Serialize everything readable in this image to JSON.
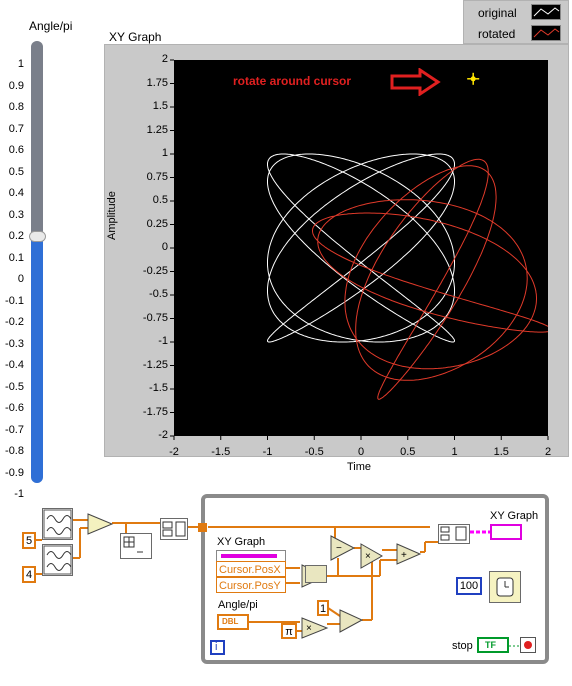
{
  "slider": {
    "title": "Angle/pi",
    "tick_labels": [
      "1",
      "0.9",
      "0.8",
      "0.7",
      "0.6",
      "0.5",
      "0.4",
      "0.3",
      "0.2",
      "0.1",
      "0",
      "-0.1",
      "-0.2",
      "-0.3",
      "-0.4",
      "-0.5",
      "-0.6",
      "-0.7",
      "-0.8",
      "-0.9",
      "-1"
    ],
    "value": 0.12,
    "min": -1,
    "max": 1,
    "fill_color": "#2f6fd6"
  },
  "graph": {
    "title": "XY Graph",
    "legend": [
      {
        "label": "original",
        "color": "#ffffff"
      },
      {
        "label": "rotated",
        "color": "#e03a2a"
      }
    ],
    "annotation": "rotate around cursor",
    "annotation_color": "#e02020",
    "cursor_color": "#ffe600"
  },
  "chart_data": {
    "type": "line",
    "xlabel": "Time",
    "ylabel": "Amplitude",
    "xlim": [
      -2,
      2
    ],
    "ylim": [
      -2,
      2
    ],
    "x_ticks": [
      "-2",
      "-1.5",
      "-1",
      "-0.5",
      "0",
      "0.5",
      "1",
      "1.5",
      "2"
    ],
    "y_ticks": [
      "2",
      "1.75",
      "1.5",
      "1.25",
      "1",
      "0.75",
      "0.5",
      "0.25",
      "0",
      "-0.25",
      "-0.5",
      "-0.75",
      "-1",
      "-1.25",
      "-1.5",
      "-1.75",
      "-2"
    ],
    "grid": false,
    "series": [
      {
        "name": "original",
        "frequencies": [
          5,
          4
        ],
        "color": "#ffffff"
      },
      {
        "name": "rotated",
        "frequencies": [
          5,
          4
        ],
        "rotation_pi": 0.12,
        "center": [
          1.2,
          1.8
        ],
        "color": "#e03a2a"
      }
    ],
    "cursor": {
      "x": 1.2,
      "y": 1.8
    }
  },
  "block_diagram": {
    "const_5": "5",
    "const_4": "4",
    "xy_graph_label": "XY Graph",
    "xy_graph_terminal": "XY Graph",
    "cursor_posx": "Cursor.PosX",
    "cursor_posy": "Cursor.PosY",
    "angle_label": "Angle/pi",
    "angle_terminal": "DBL",
    "pi_symbol": "π",
    "const_1": "1",
    "const_100": "100",
    "stop_label": "stop",
    "stop_terminal": "TF",
    "loop_index": "i"
  }
}
